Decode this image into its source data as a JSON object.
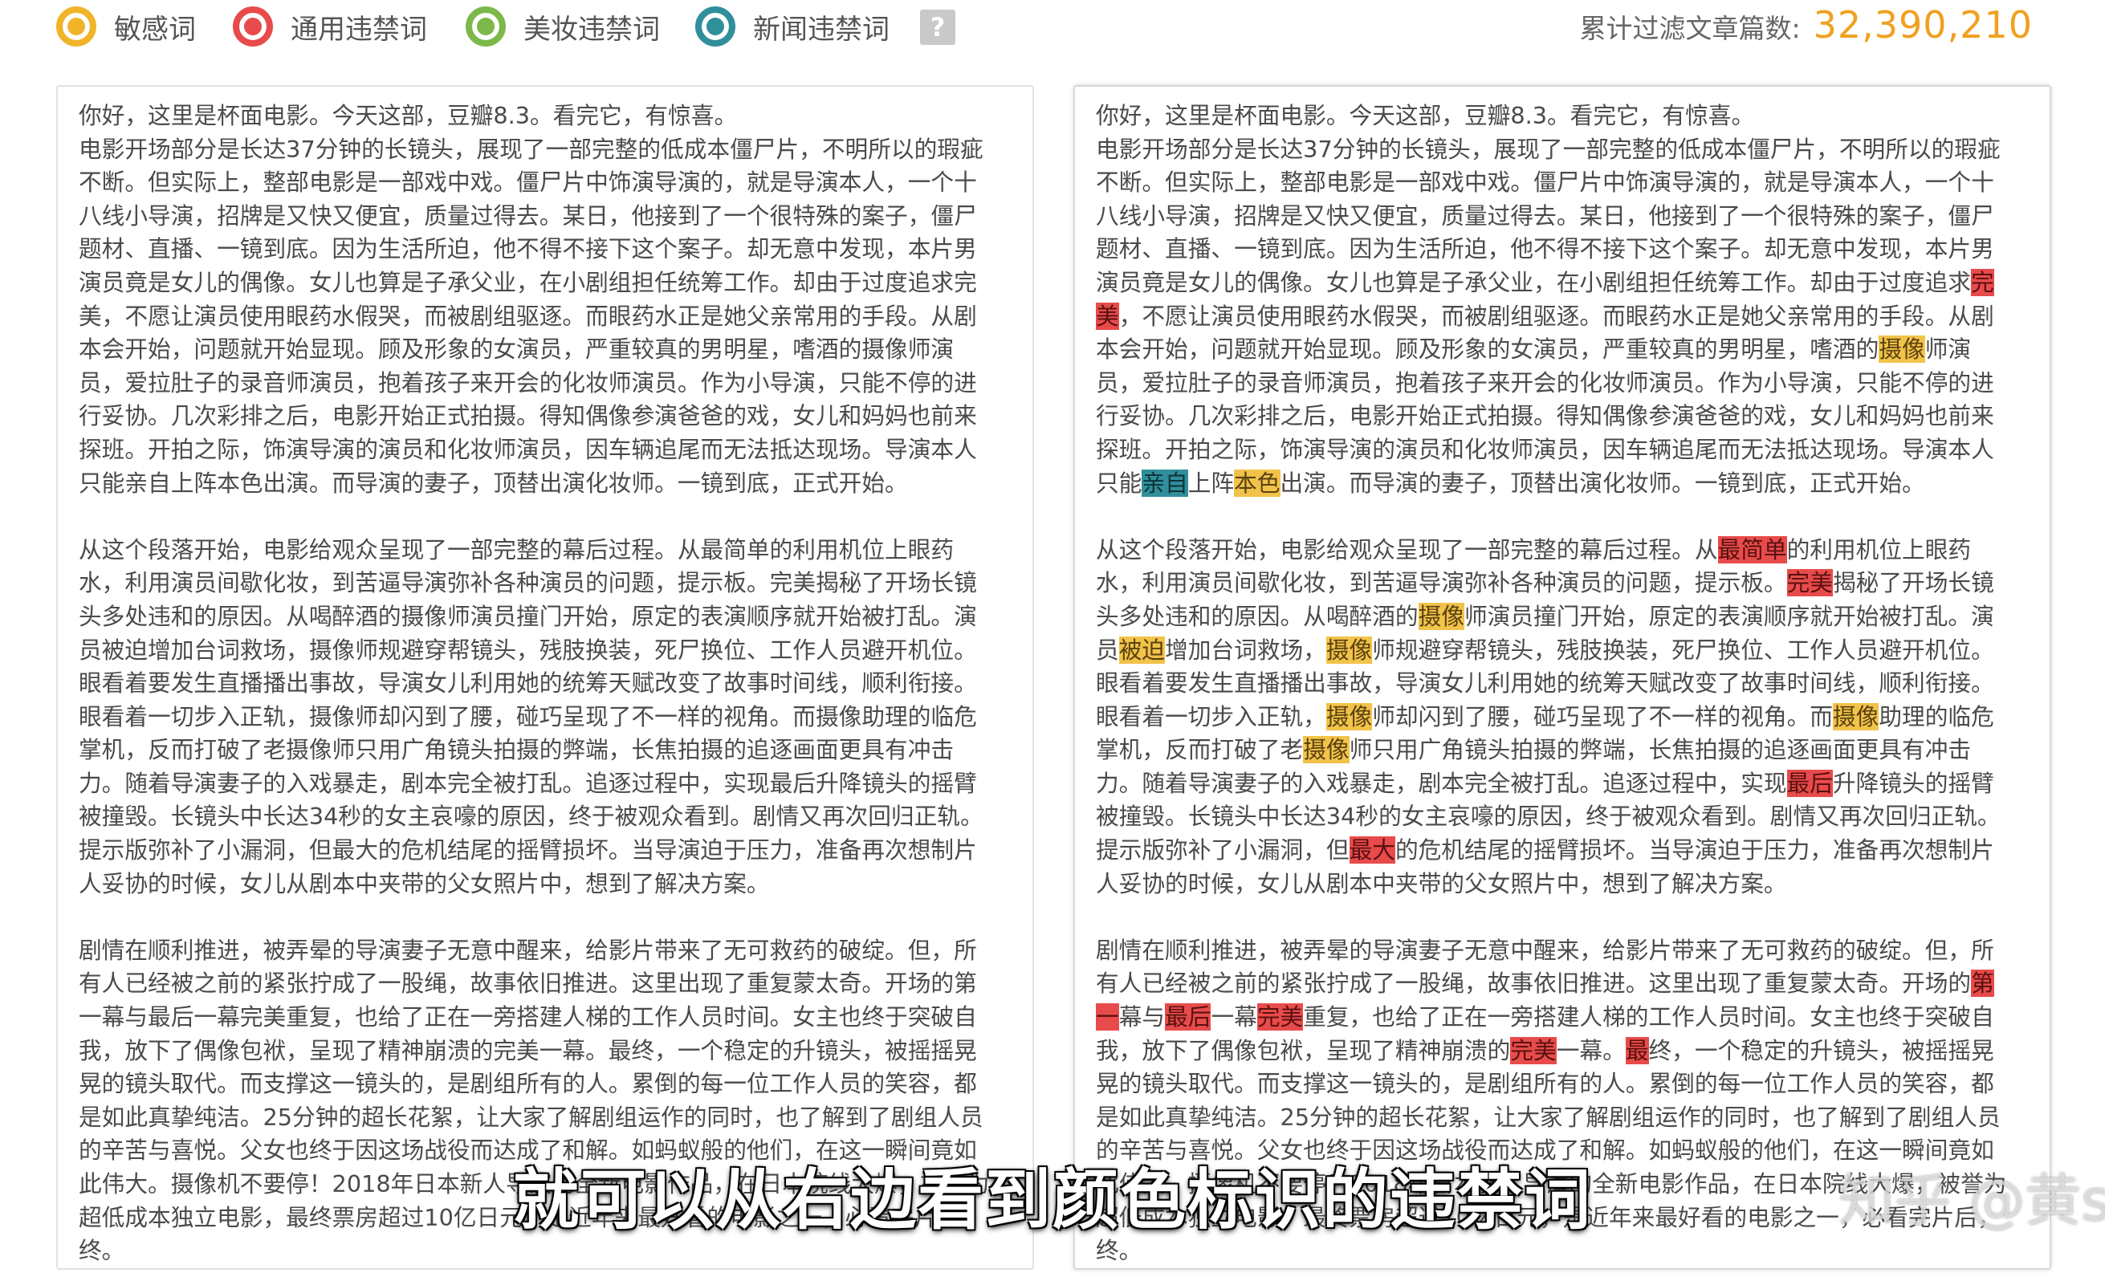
{
  "legend": [
    {
      "label": "敏感词",
      "color": "#f0b429",
      "icon": "sensitive-word-dot-icon"
    },
    {
      "label": "通用违禁词",
      "color": "#e84b4b",
      "icon": "general-banned-dot-icon"
    },
    {
      "label": "美妆违禁词",
      "color": "#7db84a",
      "icon": "beauty-banned-dot-icon"
    },
    {
      "label": "新闻违禁词",
      "color": "#2f8f9a",
      "icon": "news-banned-dot-icon"
    }
  ],
  "help_icon": "?",
  "counter": {
    "label": "累计过滤文章篇数:",
    "value": "32,390,210"
  },
  "left_lines": [
    "你好，这里是杯面电影。今天这部，豆瓣8.3。看完它，有惊喜。",
    "电影开场部分是长达37分钟的长镜头，展现了一部完整的低成本僵尸片，不明所以的瑕疵",
    "不断。但实际上，整部电影是一部戏中戏。僵尸片中饰演导演的，就是导演本人，一个十",
    "八线小导演，招牌是又快又便宜，质量过得去。某日，他接到了一个很特殊的案子，僵尸",
    "题材、直播、一镜到底。因为生活所迫，他不得不接下这个案子。却无意中发现，本片男",
    "演员竟是女儿的偶像。女儿也算是子承父业，在小剧组担任统筹工作。却由于过度追求完",
    "美，不愿让演员使用眼药水假哭，而被剧组驱逐。而眼药水正是她父亲常用的手段。从剧",
    "本会开始，问题就开始显现。顾及形象的女演员，严重较真的男明星，嗜酒的摄像师演",
    "员，爱拉肚子的录音师演员，抱着孩子来开会的化妆师演员。作为小导演，只能不停的进",
    "行妥协。几次彩排之后，电影开始正式拍摄。得知偶像参演爸爸的戏，女儿和妈妈也前来",
    "探班。开拍之际，饰演导演的演员和化妆师演员，因车辆追尾而无法抵达现场。导演本人",
    "只能亲自上阵本色出演。而导演的妻子，顶替出演化妆师。一镜到底，正式开始。",
    "",
    "从这个段落开始，电影给观众呈现了一部完整的幕后过程。从最简单的利用机位上眼药",
    "水，利用演员间歇化妆，到苦逼导演弥补各种演员的问题，提示板。完美揭秘了开场长镜",
    "头多处违和的原因。从喝醉酒的摄像师演员撞门开始，原定的表演顺序就开始被打乱。演",
    "员被迫增加台词救场，摄像师规避穿帮镜头，残肢换装，死尸换位、工作人员避开机位。",
    "眼看着要发生直播播出事故，导演女儿利用她的统筹天赋改变了故事时间线，顺利衔接。",
    "眼看着一切步入正轨，摄像师却闪到了腰，碰巧呈现了不一样的视角。而摄像助理的临危",
    "掌机，反而打破了老摄像师只用广角镜头拍摄的弊端，长焦拍摄的追逐画面更具有冲击",
    "力。随着导演妻子的入戏暴走，剧本完全被打乱。追逐过程中，实现最后升降镜头的摇臂",
    "被撞毁。长镜头中长达34秒的女主哀嚎的原因，终于被观众看到。剧情又再次回归正轨。",
    "提示版弥补了小漏洞，但最大的危机结尾的摇臂损坏。当导演迫于压力，准备再次想制片",
    "人妥协的时候，女儿从剧本中夹带的父女照片中，想到了解决方案。",
    "",
    "剧情在顺利推进，被弄晕的导演妻子无意中醒来，给影片带来了无可救药的破绽。但，所",
    "有人已经被之前的紧张拧成了一股绳，故事依旧推进。这里出现了重复蒙太奇。开场的第",
    "一幕与最后一幕完美重复，也给了正在一旁搭建人梯的工作人员时间。女主也终于突破自",
    "我，放下了偶像包袱，呈现了精神崩溃的完美一幕。最终，一个稳定的升镜头，被摇摇晃",
    "晃的镜头取代。而支撑这一镜头的，是剧组所有的人。累倒的每一位工作人员的笑容，都",
    "是如此真挚纯洁。25分钟的超长花絮，让大家了解剧组运作的同时，也了解到了剧组人员",
    "的辛苦与喜悦。父女也终于因这场战役而达成了和解。如蚂蚁般的他们，在这一瞬间竟如",
    "此伟大。摄像机不要停！2018年日本新人导演的全新电影作品，在日本院线大爆，被誉为",
    "超低成本独立电影，最终票房超过10亿日元，是近年来最好看的电影之一，必看完片后，",
    "终。"
  ],
  "right_lines": [
    [
      "你好，这里是杯面电影。今天这部，豆瓣8.3。看完它，有惊喜。"
    ],
    [
      "电影开场部分是长达37分钟的长镜头，展现了一部完整的低成本僵尸片，不明所以的瑕疵"
    ],
    [
      "不断。但实际上，整部电影是一部戏中戏。僵尸片中饰演导演的，就是导演本人，一个十"
    ],
    [
      "八线小导演，招牌是又快又便宜，质量过得去。某日，他接到了一个很特殊的案子，僵尸"
    ],
    [
      "题材、直播、一镜到底。因为生活所迫，他不得不接下这个案子。却无意中发现，本片男"
    ],
    [
      "演员竟是女儿的偶像。女儿也算是子承父业，在小剧组担任统筹工作。却由于过度追求",
      {
        "t": "完",
        "c": "red"
      }
    ],
    [
      {
        "t": "美",
        "c": "red"
      },
      "，不愿让演员使用眼药水假哭，而被剧组驱逐。而眼药水正是她父亲常用的手段。从剧"
    ],
    [
      "本会开始，问题就开始显现。顾及形象的女演员，严重较真的男明星，嗜酒的",
      {
        "t": "摄像",
        "c": "yellow"
      },
      "师演"
    ],
    [
      "员，爱拉肚子的录音师演员，抱着孩子来开会的化妆师演员。作为小导演，只能不停的进"
    ],
    [
      "行妥协。几次彩排之后，电影开始正式拍摄。得知偶像参演爸爸的戏，女儿和妈妈也前来"
    ],
    [
      "探班。开拍之际，饰演导演的演员和化妆师演员，因车辆追尾而无法抵达现场。导演本人"
    ],
    [
      "只能",
      {
        "t": "亲自",
        "c": "teal"
      },
      "上阵",
      {
        "t": "本色",
        "c": "yellow"
      },
      "出演。而导演的妻子，顶替出演化妆师。一镜到底，正式开始。"
    ],
    [],
    [
      "从这个段落开始，电影给观众呈现了一部完整的幕后过程。从",
      {
        "t": "最简单",
        "c": "red"
      },
      "的利用机位上眼药"
    ],
    [
      "水，利用演员间歇化妆，到苦逼导演弥补各种演员的问题，提示板。",
      {
        "t": "完美",
        "c": "red"
      },
      "揭秘了开场长镜"
    ],
    [
      "头多处违和的原因。从喝醉酒的",
      {
        "t": "摄像",
        "c": "yellow"
      },
      "师演员撞门开始，原定的表演顺序就开始被打乱。演"
    ],
    [
      "员",
      {
        "t": "被迫",
        "c": "yellow"
      },
      "增加台词救场，",
      {
        "t": "摄像",
        "c": "yellow"
      },
      "师规避穿帮镜头，残肢换装，死尸换位、工作人员避开机位。"
    ],
    [
      "眼看着要发生直播播出事故，导演女儿利用她的统筹天赋改变了故事时间线，顺利衔接。"
    ],
    [
      "眼看着一切步入正轨，",
      {
        "t": "摄像",
        "c": "yellow"
      },
      "师却闪到了腰，碰巧呈现了不一样的视角。而",
      {
        "t": "摄像",
        "c": "yellow"
      },
      "助理的临危"
    ],
    [
      "掌机，反而打破了老",
      {
        "t": "摄像",
        "c": "yellow"
      },
      "师只用广角镜头拍摄的弊端，长焦拍摄的追逐画面更具有冲击"
    ],
    [
      "力。随着导演妻子的入戏暴走，剧本完全被打乱。追逐过程中，实现",
      {
        "t": "最后",
        "c": "red"
      },
      "升降镜头的摇臂"
    ],
    [
      "被撞毁。长镜头中长达34秒的女主哀嚎的原因，终于被观众看到。剧情又再次回归正轨。"
    ],
    [
      "提示版弥补了小漏洞，但",
      {
        "t": "最大",
        "c": "red"
      },
      "的危机结尾的摇臂损坏。当导演迫于压力，准备再次想制片"
    ],
    [
      "人妥协的时候，女儿从剧本中夹带的父女照片中，想到了解决方案。"
    ],
    [],
    [
      "剧情在顺利推进，被弄晕的导演妻子无意中醒来，给影片带来了无可救药的破绽。但，所"
    ],
    [
      "有人已经被之前的紧张拧成了一股绳，故事依旧推进。这里出现了重复蒙太奇。开场的",
      {
        "t": "第",
        "c": "red"
      }
    ],
    [
      {
        "t": "一",
        "c": "red"
      },
      "幕与",
      {
        "t": "最后",
        "c": "red"
      },
      "一幕",
      {
        "t": "完美",
        "c": "red"
      },
      "重复，也给了正在一旁搭建人梯的工作人员时间。女主也终于突破自"
    ],
    [
      "我，放下了偶像包袱，呈现了精神崩溃的",
      {
        "t": "完美",
        "c": "red"
      },
      "一幕。",
      {
        "t": "最",
        "c": "red"
      },
      "终，一个稳定的升镜头，被摇摇晃"
    ],
    [
      "晃的镜头取代。而支撑这一镜头的，是剧组所有的人。累倒的每一位工作人员的笑容，都"
    ],
    [
      "是如此真挚纯洁。25分钟的超长花絮，让大家了解剧组运作的同时，也了解到了剧组人员"
    ],
    [
      "的辛苦与喜悦。父女也终于因这场战役而达成了和解。如蚂蚁般的他们，在这一瞬间竟如"
    ],
    [
      "此伟大。摄像机不要停！2018年日本新人导演的全新电影作品，在日本院线大爆，被誉为"
    ],
    [
      "超低成本独立电影，最终票房超过10亿日元，是近年来最好看的电影之一，必看完片后，"
    ],
    [
      "终。"
    ]
  ],
  "subtitle": "就可以从右边看到颜色标识的违禁词",
  "watermark": "知乎 @黄sir"
}
